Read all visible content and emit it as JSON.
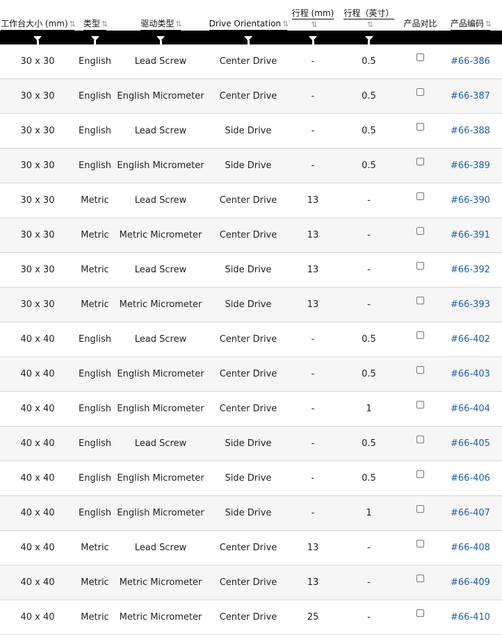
{
  "header": {
    "columns": [
      {
        "key": "size",
        "label": "工作台大小 (mm)",
        "sortable": true
      },
      {
        "key": "type",
        "label": "类型",
        "sortable": true
      },
      {
        "key": "drive",
        "label": "驱动类型",
        "sortable": true
      },
      {
        "key": "orientation",
        "label": "Drive Orientation",
        "sortable": true
      },
      {
        "key": "travel_mm",
        "label": "行程 (mm)",
        "sortable": true
      },
      {
        "key": "travel_in",
        "label": "行程（英寸）",
        "sortable": true
      },
      {
        "key": "compare",
        "label": "产品对比",
        "sortable": false
      },
      {
        "key": "code",
        "label": "产品编码",
        "sortable": true
      }
    ],
    "sort_icon": "⇅",
    "filter_icon": "funnel-icon"
  },
  "rows": [
    {
      "size": "30 x 30",
      "type": "English",
      "drive": "Lead Screw",
      "orientation": "Center Drive",
      "travel_mm": "-",
      "travel_in": "0.5",
      "code": "#66-386"
    },
    {
      "size": "30 x 30",
      "type": "English",
      "drive": "English Micrometer",
      "orientation": "Center Drive",
      "travel_mm": "-",
      "travel_in": "0.5",
      "code": "#66-387"
    },
    {
      "size": "30 x 30",
      "type": "English",
      "drive": "Lead Screw",
      "orientation": "Side Drive",
      "travel_mm": "-",
      "travel_in": "0.5",
      "code": "#66-388"
    },
    {
      "size": "30 x 30",
      "type": "English",
      "drive": "English Micrometer",
      "orientation": "Side Drive",
      "travel_mm": "-",
      "travel_in": "0.5",
      "code": "#66-389"
    },
    {
      "size": "30 x 30",
      "type": "Metric",
      "drive": "Lead Screw",
      "orientation": "Center Drive",
      "travel_mm": "13",
      "travel_in": "-",
      "code": "#66-390"
    },
    {
      "size": "30 x 30",
      "type": "Metric",
      "drive": "Metric Micrometer",
      "orientation": "Center Drive",
      "travel_mm": "13",
      "travel_in": "-",
      "code": "#66-391"
    },
    {
      "size": "30 x 30",
      "type": "Metric",
      "drive": "Lead Screw",
      "orientation": "Side Drive",
      "travel_mm": "13",
      "travel_in": "-",
      "code": "#66-392"
    },
    {
      "size": "30 x 30",
      "type": "Metric",
      "drive": "Metric Micrometer",
      "orientation": "Side Drive",
      "travel_mm": "13",
      "travel_in": "-",
      "code": "#66-393"
    },
    {
      "size": "40 x 40",
      "type": "English",
      "drive": "Lead Screw",
      "orientation": "Center Drive",
      "travel_mm": "-",
      "travel_in": "0.5",
      "code": "#66-402"
    },
    {
      "size": "40 x 40",
      "type": "English",
      "drive": "English Micrometer",
      "orientation": "Center Drive",
      "travel_mm": "-",
      "travel_in": "0.5",
      "code": "#66-403"
    },
    {
      "size": "40 x 40",
      "type": "English",
      "drive": "English Micrometer",
      "orientation": "Center Drive",
      "travel_mm": "-",
      "travel_in": "1",
      "code": "#66-404"
    },
    {
      "size": "40 x 40",
      "type": "English",
      "drive": "Lead Screw",
      "orientation": "Side Drive",
      "travel_mm": "-",
      "travel_in": "0.5",
      "code": "#66-405"
    },
    {
      "size": "40 x 40",
      "type": "English",
      "drive": "English Micrometer",
      "orientation": "Side Drive",
      "travel_mm": "-",
      "travel_in": "0.5",
      "code": "#66-406"
    },
    {
      "size": "40 x 40",
      "type": "English",
      "drive": "English Micrometer",
      "orientation": "Side Drive",
      "travel_mm": "-",
      "travel_in": "1",
      "code": "#66-407"
    },
    {
      "size": "40 x 40",
      "type": "Metric",
      "drive": "Lead Screw",
      "orientation": "Center Drive",
      "travel_mm": "13",
      "travel_in": "-",
      "code": "#66-408"
    },
    {
      "size": "40 x 40",
      "type": "Metric",
      "drive": "Metric Micrometer",
      "orientation": "Center Drive",
      "travel_mm": "13",
      "travel_in": "-",
      "code": "#66-409"
    },
    {
      "size": "40 x 40",
      "type": "Metric",
      "drive": "Metric Micrometer",
      "orientation": "Center Drive",
      "travel_mm": "25",
      "travel_in": "-",
      "code": "#66-410"
    }
  ],
  "colors": {
    "filter_bar": "#000000",
    "link": "#1f5ea8",
    "row_alt": "#f6f6f6",
    "sort_icon": "#999999"
  }
}
